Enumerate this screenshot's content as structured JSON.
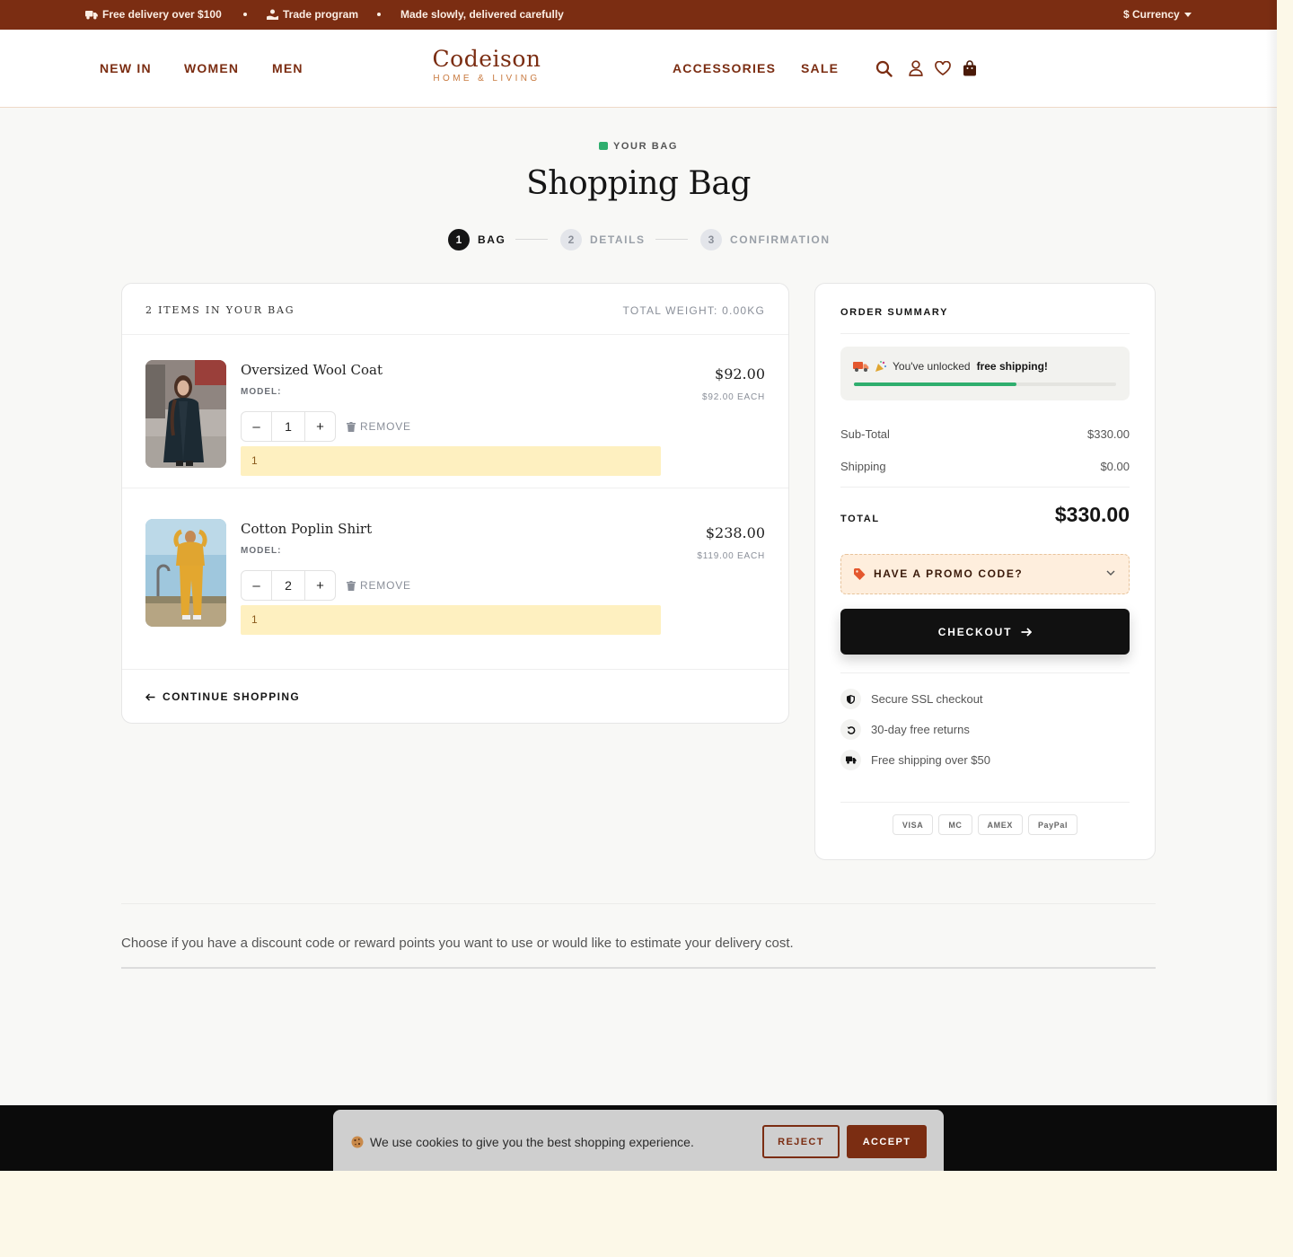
{
  "announcement": {
    "messages": [
      "Free delivery over $100",
      "Trade program",
      "Made slowly, delivered carefully"
    ],
    "currency_label": "$ Currency"
  },
  "header": {
    "nav_left": [
      "NEW IN",
      "WOMEN",
      "MEN"
    ],
    "nav_right": [
      "ACCESSORIES",
      "SALE"
    ],
    "logo_name": "Codeison",
    "logo_tagline": "HOME & LIVING",
    "icons": [
      "search-icon",
      "account-icon",
      "wishlist-icon",
      "bag-icon"
    ]
  },
  "page": {
    "eyebrow": "YOUR BAG",
    "title": "Shopping Bag"
  },
  "steps": [
    {
      "number": "1",
      "label": "BAG",
      "active": true
    },
    {
      "number": "2",
      "label": "DETAILS",
      "active": false
    },
    {
      "number": "3",
      "label": "CONFIRMATION",
      "active": false
    }
  ],
  "cart": {
    "item_count_label": "2 ITEMS IN YOUR BAG",
    "weight_label": "TOTAL WEIGHT: 0.00KG",
    "model_label": "MODEL:",
    "remove_label": "REMOVE",
    "items": [
      {
        "name": "Oversized Wool Coat",
        "quantity": "1",
        "note": "1",
        "price": "$92.00",
        "each": "$92.00 EACH"
      },
      {
        "name": "Cotton Poplin Shirt",
        "quantity": "2",
        "note": "1",
        "price": "$238.00",
        "each": "$119.00 EACH"
      }
    ],
    "continue_label": "CONTINUE SHOPPING"
  },
  "summary": {
    "title": "ORDER SUMMARY",
    "shipping_message": "You've unlocked",
    "shipping_message_bold": "free shipping!",
    "shipping_progress": 0.62,
    "subtotal_label": "Sub-Total",
    "subtotal_value": "$330.00",
    "shipping_label": "Shipping",
    "shipping_value": "$0.00",
    "total_label": "TOTAL",
    "total_value": "$330.00",
    "promo_label": "HAVE A PROMO CODE?",
    "checkout_label": "CHECKOUT",
    "trust": [
      "Secure SSL checkout",
      "30-day free returns",
      "Free shipping over $50"
    ],
    "payment_methods": [
      "VISA",
      "MC",
      "AMEX",
      "PayPal"
    ]
  },
  "bottom": {
    "note": "Choose if you have a discount code or reward points you want to use or would like to estimate your delivery cost."
  },
  "cookie": {
    "message": "We use cookies to give you the best shopping experience.",
    "reject_label": "REJECT",
    "accept_label": "ACCEPT"
  },
  "colors": {
    "brand": "#7b2d12",
    "accent_green": "#2fae6e",
    "checkout": "#111111"
  }
}
